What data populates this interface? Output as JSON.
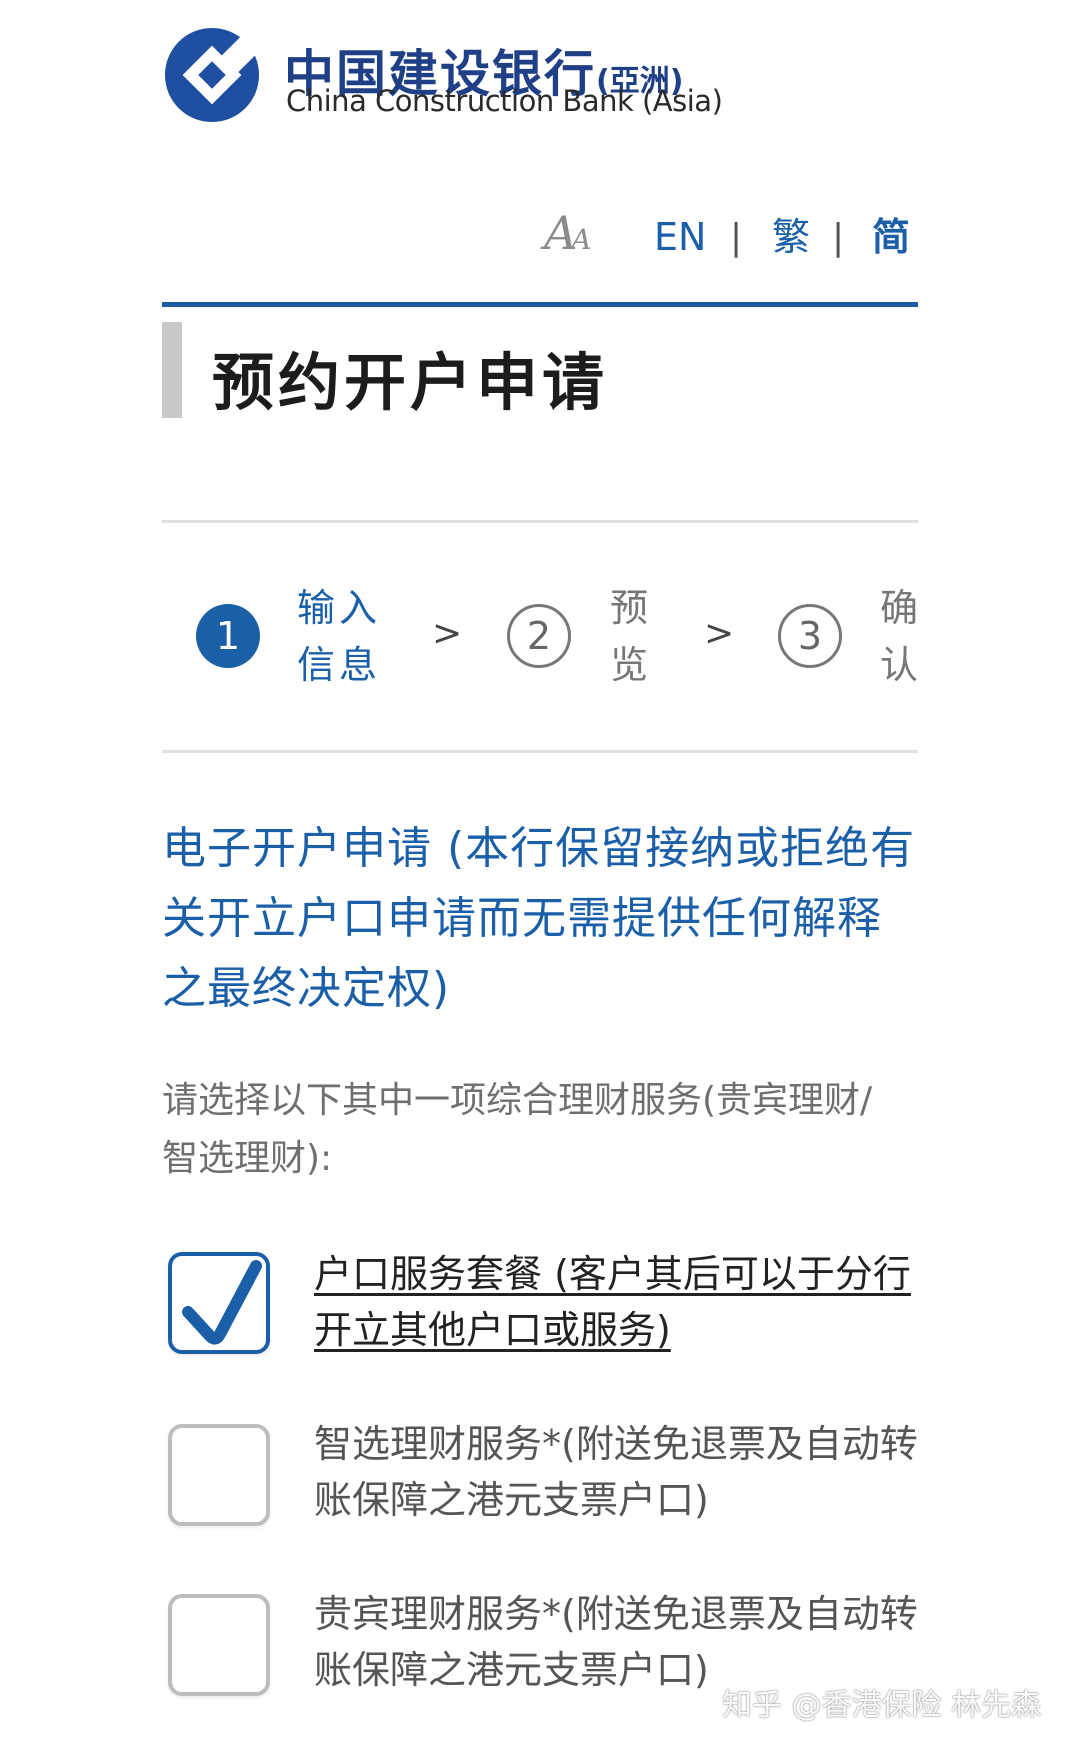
{
  "header": {
    "logo_name": "ccb-logo",
    "bank_name_cn": "中国建设银行",
    "bank_name_cn_suffix": "(亞洲)",
    "bank_name_en": "China Construction Bank (Asia)",
    "brand_color": "#1f3f86"
  },
  "language_bar": {
    "font_size_icon": "font-size-icon",
    "languages": [
      "EN",
      "繁",
      "简"
    ],
    "separator": "|",
    "active_language": "简"
  },
  "page": {
    "title": "预约开户申请"
  },
  "steps": [
    {
      "number": "1",
      "label": "输入信息",
      "active": true
    },
    {
      "number": "2",
      "label": "预览",
      "active": false
    },
    {
      "number": "3",
      "label": "确认",
      "active": false
    }
  ],
  "step_separator": ">",
  "notice": "电子开户申请 (本行保留接纳或拒绝有关开立户口申请而无需提供任何解释之最终决定权)",
  "prompt": "请选择以下其中一项综合理财服务(贵宾理财/智选理财):",
  "options": [
    {
      "label": "户口服务套餐 (客户其后可以于分行开立其他户口或服务)",
      "checked": true
    },
    {
      "label": "智选理财服务*(附送免退票及自动转账保障之港元支票户口)",
      "checked": false
    },
    {
      "label": "贵宾理财服务*(附送免退票及自动转账保障之港元支票户口)",
      "checked": false
    }
  ],
  "watermark": "知乎 @香港保险 林先森",
  "colors": {
    "accent": "#1a5fa8",
    "rule": "#1d5a9f",
    "muted": "#777777"
  }
}
